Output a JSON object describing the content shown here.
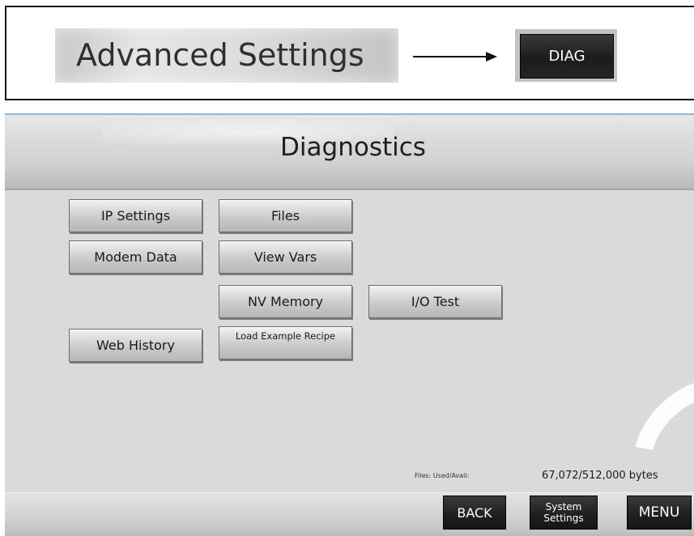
{
  "instruction": {
    "label": "Advanced Settings",
    "target": "DIAG"
  },
  "screen": {
    "title": "Diagnostics",
    "buttons": {
      "ip_settings": "IP Settings",
      "files": "Files",
      "modem_data": "Modem Data",
      "view_vars": "View Vars",
      "nv_memory": "NV Memory",
      "io_test": "I/O Test",
      "web_history": "Web History",
      "load_example_recipe": "Load Example Recipe"
    },
    "status": {
      "files_label": "Files: Used/Avail:",
      "files_value": "67,072/512,000 bytes"
    },
    "nav": {
      "back": "BACK",
      "system_settings_line1": "System",
      "system_settings_line2": "Settings",
      "menu": "MENU"
    }
  },
  "colors": {
    "screen_bg": "#dadada",
    "nav_button_bg": "#1f1f1f",
    "accent_line": "#8fb4d6"
  }
}
